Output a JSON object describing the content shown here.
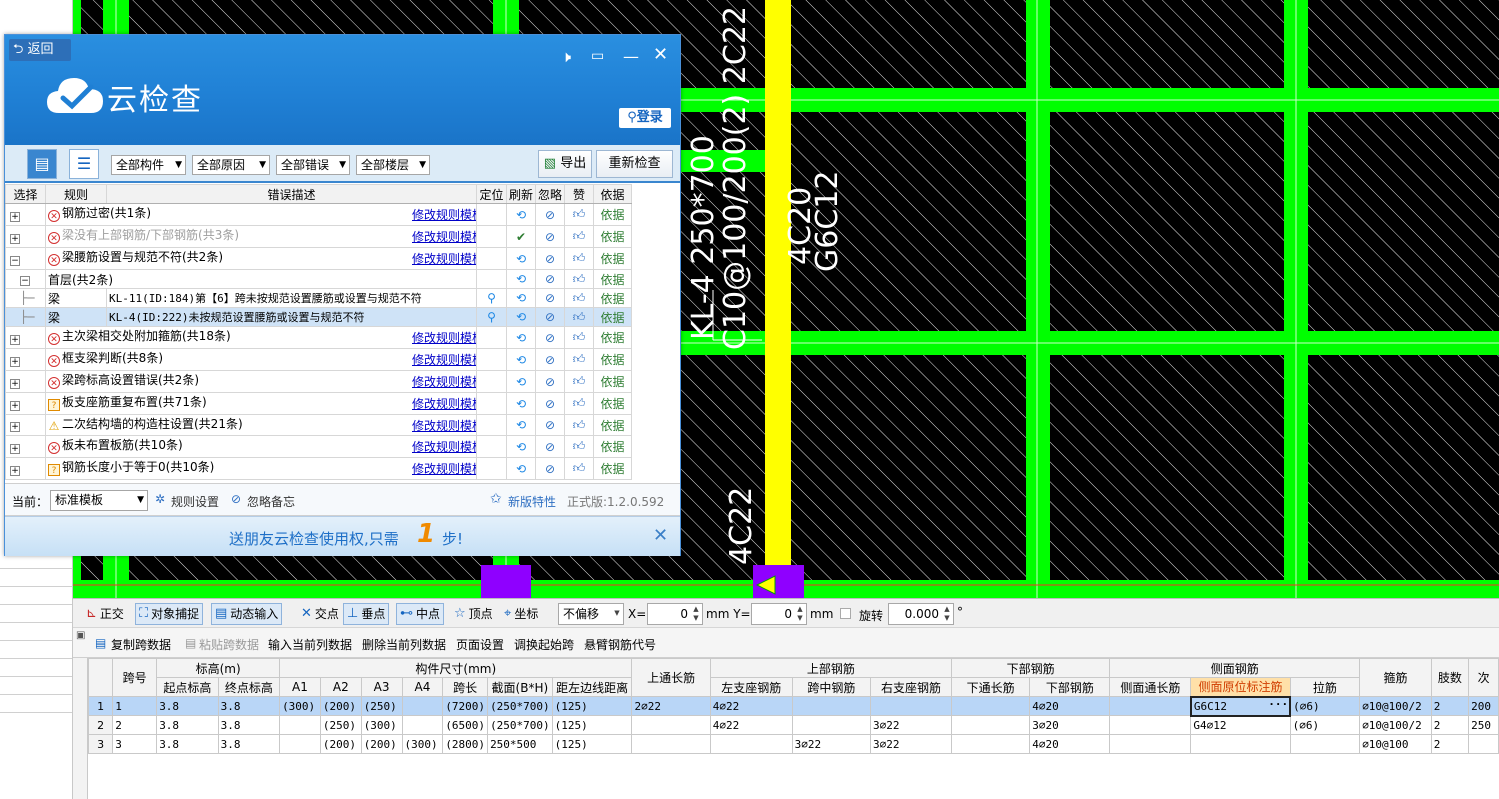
{
  "canvas": {
    "labels": {
      "beam_name": "KL-4 250*700",
      "stirrup": "C10@100/200(2) 2C22",
      "mid_top": "4C20",
      "side_bar": "G6C12",
      "bottom_bar": "4C22"
    },
    "colors": {
      "background": "#000000",
      "grid_lines": "#00ff00",
      "highlight_beam": "#ffff00",
      "column_fill": "#8f00ff"
    }
  },
  "dialog": {
    "back_label": "返回",
    "title": "云检查",
    "login_label": "登录",
    "header_icons": [
      "speaker-icon",
      "chat-icon",
      "minimize-icon",
      "close-icon"
    ],
    "filters": [
      "全部构件",
      "全部原因",
      "全部错误",
      "全部楼层"
    ],
    "export_label": "导出",
    "recheck_label": "重新检查",
    "columns": [
      "选择",
      "规则",
      "错误描述",
      "定位",
      "刷新",
      "忽略",
      "赞",
      "依据"
    ],
    "rows": [
      {
        "expander": "+",
        "icon": "error",
        "rule": "钢筋过密(共1条)",
        "desc": "修改规则模板",
        "basis": "依据",
        "disabled": false
      },
      {
        "expander": "+",
        "icon": "error",
        "rule": "梁没有上部钢筋/下部钢筋(共3条)",
        "desc": "修改规则模板",
        "basis": "依据",
        "disabled": true
      },
      {
        "expander": "−",
        "icon": "error",
        "rule": "梁腰筋设置与规范不符(共2条)",
        "desc": "修改规则模板",
        "basis": "依据",
        "disabled": false
      },
      {
        "expander": "−",
        "icon": "",
        "rule": "首层(共2条)",
        "desc": "",
        "basis": "依据",
        "level": 1
      },
      {
        "expander": "",
        "icon": "",
        "rule": "梁",
        "desc": "KL-11(ID:184)第【6】跨未按规范设置腰筋或设置与规范不符",
        "basis": "依据",
        "level": 2,
        "locate": true
      },
      {
        "expander": "",
        "icon": "",
        "rule": "梁",
        "desc": "KL-4(ID:222)未按规范设置腰筋或设置与规范不符",
        "basis": "依据",
        "level": 2,
        "locate": true,
        "selected": true
      },
      {
        "expander": "+",
        "icon": "error",
        "rule": "主次梁相交处附加箍筋(共18条)",
        "desc": "修改规则模板",
        "basis": "依据"
      },
      {
        "expander": "+",
        "icon": "error",
        "rule": "框支梁判断(共8条)",
        "desc": "修改规则模板",
        "basis": "依据"
      },
      {
        "expander": "+",
        "icon": "error",
        "rule": "梁跨标高设置错误(共2条)",
        "desc": "修改规则模板",
        "basis": "依据"
      },
      {
        "expander": "+",
        "icon": "question",
        "rule": "板支座筋重复布置(共71条)",
        "desc": "修改规则模板",
        "basis": "依据"
      },
      {
        "expander": "+",
        "icon": "warning",
        "rule": "二次结构墙的构造柱设置(共21条)",
        "desc": "修改规则模板",
        "basis": "依据"
      },
      {
        "expander": "+",
        "icon": "error",
        "rule": "板未布置板筋(共10条)",
        "desc": "修改规则模板",
        "basis": "依据"
      },
      {
        "expander": "+",
        "icon": "question",
        "rule": "钢筋长度小于等于0(共10条)",
        "desc": "修改规则模板",
        "basis": "依据"
      }
    ],
    "footer": {
      "current_label": "当前：",
      "template": "标准模板",
      "rule_settings": "规则设置",
      "ignore_notes": "忽略备忘",
      "new_features": "新版特性",
      "version": "正式版:1.2.0.592"
    },
    "banner": {
      "text_before": "送朋友云检查使用权,只需",
      "number": "1",
      "text_after": "步!"
    }
  },
  "snapbar": {
    "items": [
      "正交",
      "对象捕捉",
      "动态输入",
      "交点",
      "垂点",
      "中点",
      "顶点",
      "坐标"
    ],
    "offset_select": "不偏移",
    "x_label": "X=",
    "x_value": "0",
    "y_label": "mm Y=",
    "y_value": "0",
    "mm": "mm",
    "rotate_label": "旋转",
    "rotate_value": "0.000",
    "degree": "°"
  },
  "editbar": {
    "items": [
      "复制跨数据",
      "粘贴跨数据",
      "输入当前列数据",
      "删除当前列数据",
      "页面设置",
      "调换起始跨",
      "悬臂钢筋代号"
    ]
  },
  "span_table": {
    "group_headers": [
      "标高(m)",
      "构件尺寸(mm)",
      "上部钢筋",
      "下部钢筋",
      "侧面钢筋"
    ],
    "headers": [
      "跨号",
      "起点标高",
      "终点标高",
      "A1",
      "A2",
      "A3",
      "A4",
      "跨长",
      "截面(B*H)",
      "距左边线距离",
      "上通长筋",
      "左支座钢筋",
      "跨中钢筋",
      "右支座钢筋",
      "下通长筋",
      "下部钢筋",
      "侧面通长筋",
      "侧面原位标注筋",
      "拉筋",
      "箍筋",
      "肢数",
      "次"
    ],
    "rows": [
      {
        "n": "1",
        "cells": [
          "1",
          "3.8",
          "3.8",
          "(300)",
          "(200)",
          "(250)",
          "",
          "(7200)",
          "(250*700)",
          "(125)",
          "2⌀22",
          "4⌀22",
          "",
          "",
          "",
          "4⌀20",
          "",
          "G6C12",
          "(⌀6)",
          "⌀10@100/2",
          "2",
          "200"
        ]
      },
      {
        "n": "2",
        "cells": [
          "2",
          "3.8",
          "3.8",
          "",
          "(250)",
          "(300)",
          "",
          "(6500)",
          "(250*700)",
          "(125)",
          "",
          "4⌀22",
          "",
          "3⌀22",
          "",
          "3⌀20",
          "",
          "G4⌀12",
          "(⌀6)",
          "⌀10@100/2",
          "2",
          "250"
        ]
      },
      {
        "n": "3",
        "cells": [
          "3",
          "3.8",
          "3.8",
          "",
          "(200)",
          "(200)",
          "(300)",
          "(2800)",
          "250*500",
          "(125)",
          "",
          "",
          "3⌀22",
          "3⌀22",
          "",
          "4⌀20",
          "",
          "",
          "",
          "⌀10@100",
          "2",
          ""
        ]
      }
    ]
  }
}
